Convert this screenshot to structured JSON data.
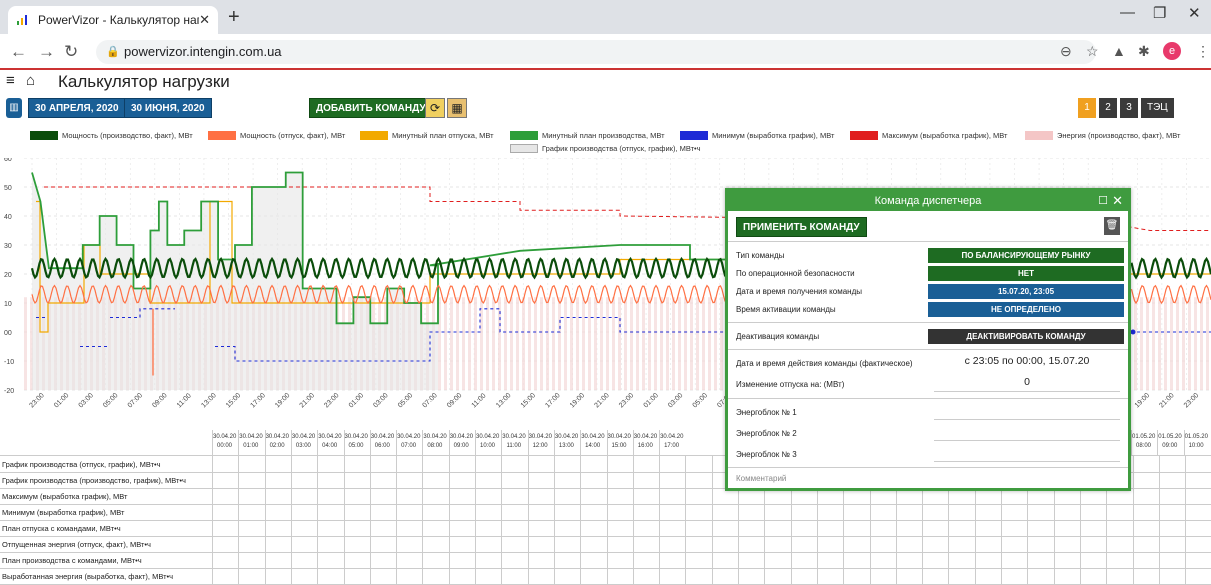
{
  "browser": {
    "tab_title": "PowerVizor - Калькулятор нагрузки",
    "tab_close": "✕",
    "new_tab": "+",
    "url": "powervizor.intengin.com.ua",
    "avatar_letter": "e"
  },
  "app": {
    "title": "Калькулятор нагрузки"
  },
  "toolbar": {
    "date_from": "30 АПРЕЛЯ, 2020",
    "date_to": "30 ИЮНЯ, 2020",
    "add_command": "ДОБАВИТЬ КОМАНДУ",
    "pages": [
      "1",
      "2",
      "3"
    ],
    "tec": "ТЭЦ",
    "active_page": "1"
  },
  "legend": [
    {
      "label": "Мощность (производство, факт), МВт",
      "color": "#0b4d0b"
    },
    {
      "label": "Мощность (отпуск, факт), МВт",
      "color": "#ff7043"
    },
    {
      "label": "Минутный план отпуска, МВт",
      "color": "#f2a900"
    },
    {
      "label": "Минутный план производства, МВт",
      "color": "#2e9e3a"
    },
    {
      "label": "Минимум (выработка график), МВт",
      "color": "#1e2bd6"
    },
    {
      "label": "Максимум (выработка график), МВт",
      "color": "#e01e1e"
    },
    {
      "label": "Энергия (производство, факт), МВт",
      "color": "#f4c6c6"
    },
    {
      "label": "График производства (отпуск, график), МВт•ч",
      "color": "#e6e6e6"
    }
  ],
  "chart_data": {
    "type": "line",
    "y_ticks": [
      "60",
      "50",
      "40",
      "30",
      "20",
      "10",
      "00",
      "-10",
      "-20"
    ],
    "ylim": [
      -20,
      60
    ],
    "x_ticks": [
      "23:00",
      "01:00",
      "03:00",
      "05:00",
      "07:00",
      "09:00",
      "11:00",
      "13:00",
      "15:00",
      "17:00",
      "19:00",
      "21:00",
      "23:00",
      "01:00",
      "03:00",
      "05:00",
      "07:00",
      "09:00",
      "11:00",
      "13:00",
      "15:00",
      "17:00",
      "19:00",
      "21:00",
      "23:00",
      "01:00",
      "03:00",
      "05:00",
      "07:00",
      "09:00",
      "11:00",
      "13:00",
      "15:00",
      "17:00",
      "19:00",
      "21:00",
      "23:00",
      "01:00",
      "03:00",
      "05:00",
      "07:00",
      "09:00",
      "11:00"
    ],
    "x_ticks_right": [
      "15:00",
      "17:00",
      "19:00",
      "21:00",
      "23:00"
    ],
    "grid": true,
    "series": [
      {
        "name": "Мощность (производство, факт), МВт",
        "color": "#0b4d0b",
        "description": "sinusoid around 22 with amplitude ~3"
      },
      {
        "name": "Мощность (отпуск, факт), МВт",
        "color": "#ff7043",
        "description": "sinusoid around 13 with amplitude ~3"
      },
      {
        "name": "Минутный план производства, МВт",
        "color": "#2e9e3a",
        "steps": [
          [
            0,
            55
          ],
          [
            0.5,
            45
          ],
          [
            1,
            22
          ],
          [
            3,
            22
          ],
          [
            3,
            30
          ],
          [
            4,
            30
          ],
          [
            4,
            40
          ],
          [
            5,
            40
          ],
          [
            5,
            30
          ],
          [
            6,
            30
          ],
          [
            6,
            15
          ],
          [
            7,
            15
          ],
          [
            7,
            35
          ],
          [
            7.5,
            35
          ],
          [
            7.5,
            45
          ],
          [
            8,
            45
          ],
          [
            8,
            30
          ],
          [
            9,
            30
          ],
          [
            9,
            35
          ],
          [
            10,
            35
          ],
          [
            10,
            45
          ],
          [
            11,
            45
          ],
          [
            11,
            25
          ],
          [
            12,
            25
          ],
          [
            12,
            30
          ],
          [
            13,
            30
          ],
          [
            13,
            50
          ],
          [
            15,
            50
          ],
          [
            15,
            55
          ],
          [
            16,
            55
          ],
          [
            16,
            15
          ],
          [
            18,
            15
          ],
          [
            18,
            3
          ],
          [
            19,
            3
          ],
          [
            19,
            12
          ],
          [
            20,
            12
          ],
          [
            20,
            3
          ],
          [
            21,
            3
          ],
          [
            21,
            15
          ],
          [
            22,
            15
          ],
          [
            22,
            10
          ],
          [
            23,
            10
          ],
          [
            23,
            3
          ],
          [
            24,
            3
          ],
          [
            24,
            23
          ]
        ]
      },
      {
        "name": "Минимум (выработка график), МВт",
        "color": "#1e2bd6",
        "dashed": true,
        "values_mid": [
          5,
          0,
          -10,
          -5,
          8,
          8,
          0,
          -15,
          -10,
          -5,
          -5,
          -5
        ]
      },
      {
        "name": "Максимум (выработка график), МВт",
        "color": "#e01e1e",
        "dashed": true,
        "values_mid": [
          50,
          50,
          50,
          50,
          50,
          50,
          50,
          50,
          45,
          40,
          38,
          35
        ]
      },
      {
        "name": "Минутный план отпуска, МВт",
        "color": "#f2a900",
        "values_mid": [
          45,
          10,
          10,
          30,
          30,
          10,
          10,
          20,
          45,
          10,
          22,
          20
        ]
      }
    ]
  },
  "table": {
    "header_prefix": "30.04.20",
    "header_times": [
      "00:00",
      "01:00",
      "02:00",
      "03:00",
      "04:00",
      "05:00",
      "06:00",
      "07:00",
      "08:00",
      "09:00",
      "10:00",
      "11:00",
      "12:00",
      "13:00",
      "14:00",
      "15:00",
      "16:00",
      "17:00"
    ],
    "header_right_prefix": "01.05.20",
    "header_right_times": [
      "08:00",
      "09:00",
      "10:00"
    ],
    "rows": [
      "График производства (отпуск, график), МВт•ч",
      "График производства (производство, график), МВт•ч",
      "Максимум (выработка график), МВт",
      "Минимум (выработка график), МВт",
      "План отпуска с командами, МВт•ч",
      "Отпущенная энергия (отпуск, факт), МВт•ч",
      "План производства с командами, МВт•ч",
      "Выработанная энергия (выработка, факт), МВт•ч"
    ]
  },
  "panel": {
    "title": "Команда диспетчера",
    "apply": "ПРИМЕНИТЬ КОМАНДУ",
    "fields": [
      {
        "label": "Тип команды",
        "value": "ПО БАЛАНСИРУЮЩЕМУ РЫНКУ",
        "color": "#1e6b22"
      },
      {
        "label": "По операционной безопасности",
        "value": "НЕТ",
        "color": "#1e6b22"
      },
      {
        "label": "Дата и время получения команды",
        "value": "15.07.20, 23:05",
        "color": "#1a5f96"
      },
      {
        "label": "Время активации команды",
        "value": "НЕ ОПРЕДЕЛЕНО",
        "color": "#1a5f96"
      }
    ],
    "deactivation_label": "Деактивация команды",
    "deactivate": "ДЕАКТИВИРОВАТЬ КОМАНДУ",
    "effective_label": "Дата и время действия команды (фактическое)",
    "effective_value": "с 23:05 по 00:00, 15.07.20",
    "change_label": "Изменение отпуска на: (МВт)",
    "change_value": "0",
    "units": [
      "Энергоблок № 1",
      "Энергоблок № 2",
      "Энергоблок № 3"
    ],
    "comment": "Комментарий"
  }
}
